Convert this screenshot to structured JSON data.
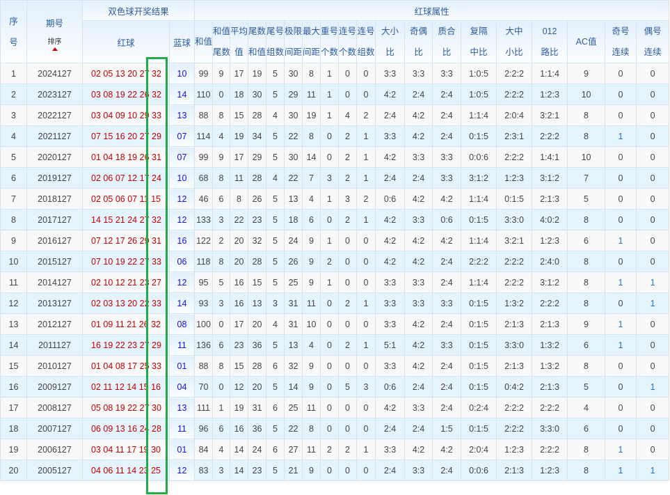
{
  "header": {
    "seq": [
      "序",
      "号"
    ],
    "issue": "期号",
    "sort_label": "排序",
    "draw_group": "双色球开奖结果",
    "attr_group": "红球属性",
    "red": "红球",
    "blue": "蓝球",
    "attr_cols": [
      [
        "和值"
      ],
      [
        "和值",
        "尾数"
      ],
      [
        "平均",
        "值"
      ],
      [
        "尾数",
        "和值"
      ],
      [
        "尾号",
        "组数"
      ],
      [
        "极限",
        "间距"
      ],
      [
        "最大",
        "间距"
      ],
      [
        "重号",
        "个数"
      ],
      [
        "连号",
        "个数"
      ],
      [
        "连号",
        "组数"
      ],
      [
        "大小",
        "比"
      ],
      [
        "奇偶",
        "比"
      ],
      [
        "质合",
        "比"
      ],
      [
        "复隔",
        "中比"
      ],
      [
        "大中",
        "小比"
      ],
      [
        "012",
        "路比"
      ],
      [
        "AC值"
      ],
      [
        "奇号",
        "连续"
      ],
      [
        "偶号",
        "连续"
      ]
    ]
  },
  "rows": [
    {
      "n": "1",
      "issue": "2024127",
      "red": [
        "02",
        "05",
        "13",
        "20",
        "27",
        "32"
      ],
      "blue": "10",
      "a": [
        "99",
        "9",
        "17",
        "19",
        "5",
        "30",
        "8",
        "1",
        "0",
        "0",
        "3:3",
        "3:3",
        "3:3",
        "1:0:5",
        "2:2:2",
        "1:1:4",
        "9",
        "0",
        "0"
      ]
    },
    {
      "n": "2",
      "issue": "2023127",
      "red": [
        "03",
        "08",
        "19",
        "22",
        "26",
        "32"
      ],
      "blue": "14",
      "a": [
        "110",
        "0",
        "18",
        "30",
        "5",
        "29",
        "11",
        "1",
        "0",
        "0",
        "4:2",
        "2:4",
        "2:4",
        "1:0:5",
        "2:2:2",
        "1:2:3",
        "10",
        "0",
        "0"
      ]
    },
    {
      "n": "3",
      "issue": "2022127",
      "red": [
        "03",
        "04",
        "09",
        "10",
        "29",
        "33"
      ],
      "blue": "13",
      "a": [
        "88",
        "8",
        "15",
        "28",
        "4",
        "30",
        "19",
        "1",
        "4",
        "2",
        "2:4",
        "4:2",
        "2:4",
        "1:1:4",
        "2:0:4",
        "3:2:1",
        "8",
        "0",
        "0"
      ]
    },
    {
      "n": "4",
      "issue": "2021127",
      "red": [
        "07",
        "15",
        "16",
        "20",
        "27",
        "29"
      ],
      "blue": "07",
      "a": [
        "114",
        "4",
        "19",
        "34",
        "5",
        "22",
        "8",
        "0",
        "2",
        "1",
        "3:3",
        "4:2",
        "2:4",
        "0:1:5",
        "2:3:1",
        "2:2:2",
        "8",
        "1",
        "0"
      ]
    },
    {
      "n": "5",
      "issue": "2020127",
      "red": [
        "01",
        "04",
        "18",
        "19",
        "26",
        "31"
      ],
      "blue": "07",
      "a": [
        "99",
        "9",
        "17",
        "29",
        "5",
        "30",
        "14",
        "0",
        "2",
        "1",
        "4:2",
        "3:3",
        "3:3",
        "0:0:6",
        "2:2:2",
        "1:4:1",
        "10",
        "0",
        "0"
      ]
    },
    {
      "n": "6",
      "issue": "2019127",
      "red": [
        "02",
        "06",
        "07",
        "12",
        "17",
        "24"
      ],
      "blue": "10",
      "a": [
        "68",
        "8",
        "11",
        "28",
        "4",
        "22",
        "7",
        "3",
        "2",
        "1",
        "2:4",
        "2:4",
        "3:3",
        "3:1:2",
        "1:2:3",
        "3:1:2",
        "7",
        "0",
        "0"
      ]
    },
    {
      "n": "7",
      "issue": "2018127",
      "red": [
        "02",
        "05",
        "06",
        "07",
        "11",
        "15"
      ],
      "blue": "12",
      "a": [
        "46",
        "6",
        "8",
        "26",
        "5",
        "13",
        "4",
        "1",
        "3",
        "2",
        "0:6",
        "4:2",
        "4:2",
        "1:1:4",
        "0:1:5",
        "2:1:3",
        "5",
        "0",
        "0"
      ]
    },
    {
      "n": "8",
      "issue": "2017127",
      "red": [
        "14",
        "15",
        "21",
        "24",
        "27",
        "32"
      ],
      "blue": "12",
      "a": [
        "133",
        "3",
        "22",
        "23",
        "5",
        "18",
        "6",
        "0",
        "2",
        "1",
        "4:2",
        "3:3",
        "0:6",
        "0:1:5",
        "3:3:0",
        "4:0:2",
        "8",
        "0",
        "0"
      ]
    },
    {
      "n": "9",
      "issue": "2016127",
      "red": [
        "07",
        "12",
        "17",
        "26",
        "29",
        "31"
      ],
      "blue": "16",
      "a": [
        "122",
        "2",
        "20",
        "32",
        "5",
        "24",
        "9",
        "1",
        "0",
        "0",
        "4:2",
        "4:2",
        "4:2",
        "1:1:4",
        "3:2:1",
        "1:2:3",
        "6",
        "1",
        "0"
      ]
    },
    {
      "n": "10",
      "issue": "2015127",
      "red": [
        "07",
        "10",
        "19",
        "22",
        "27",
        "33"
      ],
      "blue": "06",
      "a": [
        "118",
        "8",
        "20",
        "28",
        "5",
        "26",
        "9",
        "2",
        "0",
        "0",
        "4:2",
        "4:2",
        "2:4",
        "2:2:2",
        "2:2:2",
        "2:4:0",
        "8",
        "0",
        "0"
      ]
    },
    {
      "n": "11",
      "issue": "2014127",
      "red": [
        "02",
        "10",
        "12",
        "21",
        "23",
        "27"
      ],
      "blue": "12",
      "a": [
        "95",
        "5",
        "16",
        "15",
        "5",
        "25",
        "9",
        "1",
        "0",
        "0",
        "3:3",
        "3:3",
        "2:4",
        "1:1:4",
        "2:2:2",
        "3:1:2",
        "8",
        "1",
        "1"
      ]
    },
    {
      "n": "12",
      "issue": "2013127",
      "red": [
        "02",
        "03",
        "13",
        "20",
        "22",
        "33"
      ],
      "blue": "14",
      "a": [
        "93",
        "3",
        "16",
        "13",
        "3",
        "31",
        "11",
        "0",
        "2",
        "1",
        "3:3",
        "3:3",
        "3:3",
        "0:1:5",
        "1:3:2",
        "2:2:2",
        "8",
        "0",
        "1"
      ]
    },
    {
      "n": "13",
      "issue": "2012127",
      "red": [
        "01",
        "09",
        "11",
        "21",
        "26",
        "32"
      ],
      "blue": "08",
      "a": [
        "100",
        "0",
        "17",
        "20",
        "4",
        "31",
        "10",
        "0",
        "0",
        "0",
        "3:3",
        "4:2",
        "2:4",
        "0:1:5",
        "2:1:3",
        "2:1:3",
        "9",
        "1",
        "0"
      ]
    },
    {
      "n": "14",
      "issue": "2011127",
      "red": [
        "16",
        "19",
        "22",
        "23",
        "27",
        "29"
      ],
      "blue": "11",
      "a": [
        "136",
        "6",
        "23",
        "36",
        "5",
        "13",
        "4",
        "0",
        "2",
        "1",
        "5:1",
        "4:2",
        "3:3",
        "0:1:5",
        "3:3:0",
        "1:3:2",
        "6",
        "1",
        "0"
      ]
    },
    {
      "n": "15",
      "issue": "2010127",
      "red": [
        "01",
        "04",
        "08",
        "17",
        "25",
        "33"
      ],
      "blue": "01",
      "a": [
        "88",
        "8",
        "15",
        "28",
        "6",
        "32",
        "9",
        "0",
        "0",
        "0",
        "3:3",
        "4:2",
        "2:4",
        "0:1:5",
        "2:1:3",
        "1:3:2",
        "8",
        "0",
        "0"
      ]
    },
    {
      "n": "16",
      "issue": "2009127",
      "red": [
        "02",
        "11",
        "12",
        "14",
        "15",
        "16"
      ],
      "blue": "04",
      "a": [
        "70",
        "0",
        "12",
        "20",
        "5",
        "14",
        "9",
        "0",
        "5",
        "3",
        "0:6",
        "2:4",
        "2:4",
        "0:1:5",
        "0:4:2",
        "2:1:3",
        "5",
        "0",
        "1"
      ]
    },
    {
      "n": "17",
      "issue": "2008127",
      "red": [
        "05",
        "08",
        "19",
        "22",
        "27",
        "30"
      ],
      "blue": "13",
      "a": [
        "111",
        "1",
        "19",
        "31",
        "6",
        "25",
        "11",
        "0",
        "0",
        "0",
        "4:2",
        "3:3",
        "2:4",
        "0:2:4",
        "2:2:2",
        "2:2:2",
        "4",
        "0",
        "0"
      ]
    },
    {
      "n": "18",
      "issue": "2007127",
      "red": [
        "06",
        "09",
        "13",
        "16",
        "24",
        "28"
      ],
      "blue": "11",
      "a": [
        "96",
        "6",
        "16",
        "36",
        "5",
        "22",
        "8",
        "0",
        "0",
        "0",
        "2:4",
        "2:4",
        "1:5",
        "0:1:5",
        "2:2:2",
        "3:3:0",
        "6",
        "0",
        "0"
      ]
    },
    {
      "n": "19",
      "issue": "2006127",
      "red": [
        "03",
        "04",
        "11",
        "17",
        "19",
        "30"
      ],
      "blue": "01",
      "a": [
        "84",
        "4",
        "14",
        "24",
        "6",
        "27",
        "11",
        "2",
        "2",
        "1",
        "3:3",
        "4:2",
        "4:2",
        "2:0:4",
        "1:2:3",
        "2:2:2",
        "8",
        "1",
        "0"
      ]
    },
    {
      "n": "20",
      "issue": "2005127",
      "red": [
        "04",
        "06",
        "11",
        "14",
        "23",
        "25"
      ],
      "blue": "12",
      "a": [
        "83",
        "3",
        "14",
        "23",
        "5",
        "21",
        "9",
        "0",
        "0",
        "0",
        "2:4",
        "3:3",
        "2:4",
        "0:0:6",
        "2:1:3",
        "1:2:3",
        "8",
        "1",
        "1"
      ]
    }
  ]
}
